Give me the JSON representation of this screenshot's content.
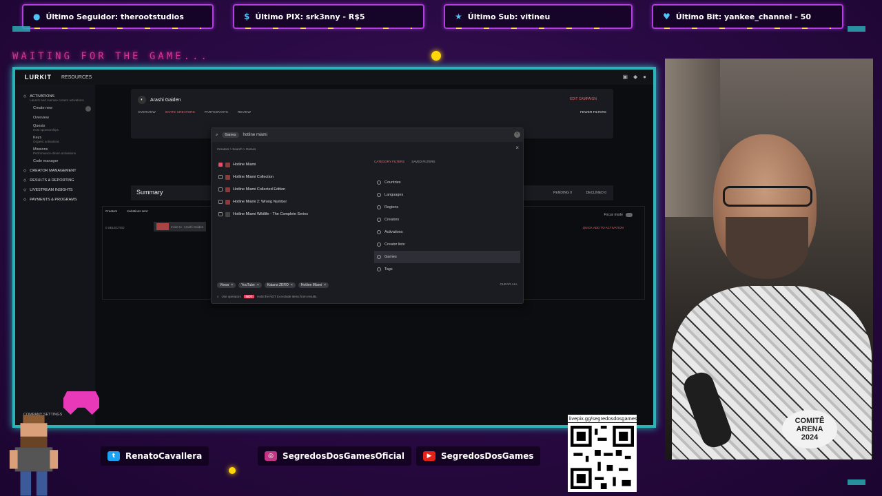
{
  "overlay": {
    "alerts": [
      {
        "icon": "user-icon",
        "text": "Último Seguidor: therootstudios"
      },
      {
        "icon": "dollar-icon",
        "text": "Último PIX: srk3nny - R$5"
      },
      {
        "icon": "star-icon",
        "text": "Último Sub: vitineu"
      },
      {
        "icon": "heart-icon",
        "text": "Último Bit: yankee_channel - 50"
      }
    ],
    "waiting_text": "WAITING FOR THE GAME...",
    "socials": [
      {
        "icon": "twitter-icon",
        "text": "RenatoCavallera"
      },
      {
        "icon": "instagram-icon",
        "text": "SegredosDosGamesOficial"
      },
      {
        "icon": "youtube-icon",
        "text": "SegredosDosGames"
      }
    ],
    "qr_label": "livepix.gg/segredosdosgames",
    "colors": {
      "frame": "#2bb3b8",
      "alert_border": "#b43ee0",
      "accent": "#e94c6a"
    }
  },
  "app": {
    "logo": "LURKIT",
    "top_menu": "RESOURCES",
    "sidebar": {
      "activations_title": "ACTIVATIONS",
      "activations_desc": "Launch and oversee creator activations",
      "create_new": "Create new",
      "items": [
        {
          "label": "Overview",
          "desc": ""
        },
        {
          "label": "Quests",
          "desc": "Host sponsorships"
        },
        {
          "label": "Keys",
          "desc": "Organic activations"
        },
        {
          "label": "Missions",
          "desc": "Performance-driven activations"
        }
      ],
      "code_manager": "Code manager",
      "sections": [
        "CREATOR MANAGEMENT",
        "RESULTS & REPORTING",
        "LIVESTREAM INSIGHTS",
        "PAYMENTS & PROGRAMS"
      ],
      "bottom": "COMPANY SETTINGS"
    },
    "campaign": {
      "name": "Arashi Gaiden",
      "edit_label": "EDIT CAMPAIGN",
      "tabs": [
        "OVERVIEW",
        "INVITE CREATORS",
        "PARTICIPANTS",
        "REVIEW"
      ],
      "active_tab": "INVITE CREATORS",
      "filter_label": "FEWER FILTERS"
    },
    "summary": {
      "title": "Summary",
      "pending_label": "PENDING",
      "pending": "0",
      "declined_label": "DECLINED",
      "declined": "0"
    },
    "table": {
      "tabs": [
        "Creators",
        "Invitations sent"
      ],
      "selected": "0 SELECTED",
      "invite_label": "Invite to",
      "invite_target": "Arashi Gaiden",
      "quick_add": "QUICK ADD TO ACTIVATION",
      "focus_mode": "Focus mode"
    },
    "filter": {
      "search_chip": "Games",
      "search_value": "hotline miami",
      "breadcrumbs": "Creators > Search > Games",
      "results": [
        {
          "label": "Hotline Miami",
          "checked": true
        },
        {
          "label": "Hotline Miami Collection",
          "checked": false
        },
        {
          "label": "Hotline Miami Collected Edition",
          "checked": false
        },
        {
          "label": "Hotline Miami 2: Wrong Number",
          "checked": false
        },
        {
          "label": "Hotline Miami Wildlife - The Complete Series",
          "checked": false
        }
      ],
      "category_tabs": [
        "CATEGORY FILTERS",
        "SAVED FILTERS"
      ],
      "categories": [
        "Countries",
        "Languages",
        "Regions",
        "Creators",
        "Activations",
        "Creator lists",
        "Games",
        "Tags"
      ],
      "selected_category": "Games",
      "selected_chips": [
        "Views",
        "YouTube",
        "Katana ZERO",
        "Hotline Miami"
      ],
      "clear_all": "CLEAR ALL",
      "tip_prefix": "Use operators",
      "tip_key": "NOT",
      "tip_suffix": "Hold the NOT to exclude items from results."
    }
  }
}
